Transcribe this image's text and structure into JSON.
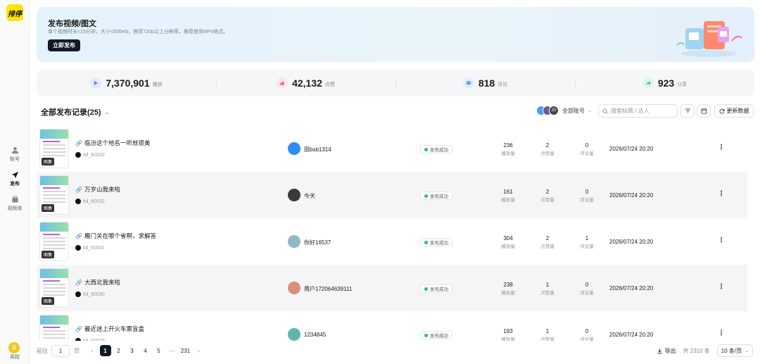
{
  "logo_text": "排停",
  "sidebar": {
    "items": [
      {
        "label": "账号",
        "icon": "user-icon"
      },
      {
        "label": "发布",
        "icon": "send-icon"
      },
      {
        "label": "视频库",
        "icon": "library-icon"
      }
    ],
    "user": {
      "avatar_text": "周",
      "label": "周程"
    }
  },
  "banner": {
    "title": "发布视频/图文",
    "subtitle": "单个视频时长<15分钟，大小<500mb，推荐720p以上分辨率，推荐使用MP4格式。",
    "button": "立即发布"
  },
  "stats": [
    {
      "value": "7,370,901",
      "label": "播放",
      "color": "#5b7ef5",
      "icon": "play-icon"
    },
    {
      "value": "42,132",
      "label": "点赞",
      "color": "#f26b7a",
      "icon": "like-icon"
    },
    {
      "value": "818",
      "label": "评论",
      "color": "#4a9cf0",
      "icon": "comment-icon"
    },
    {
      "value": "923",
      "label": "分享",
      "color": "#3fc28a",
      "icon": "share-icon"
    }
  ],
  "list": {
    "title": "全部发布记录(25)",
    "accounts": {
      "count": "20",
      "label": "全部账号"
    },
    "search_placeholder": "搜索标题 / 达人",
    "refresh_label": "更新数据"
  },
  "thumb_tag": "图集",
  "status_label": "发布成功",
  "metric_labels": {
    "plays": "播放量",
    "likes": "点赞量",
    "comments": "评论量"
  },
  "rows": [
    {
      "title": "临汾这个地名一听就很美",
      "id": "tid_60033",
      "author": "田bsb1314",
      "avatar_color": "#2f8cf4",
      "plays": "236",
      "likes": "2",
      "comments": "0",
      "date": "2026/07/24 20:20"
    },
    {
      "title": "万岁山我来啦",
      "id": "tid_60032",
      "author": "今天",
      "avatar_color": "#3a3a3a",
      "plays": "161",
      "likes": "2",
      "comments": "0",
      "date": "2026/07/24 20:20"
    },
    {
      "title": "雁门关在哪个省啊，求解答",
      "id": "tid_60031",
      "author": "你好16537",
      "avatar_color": "#8fb8c9",
      "plays": "304",
      "likes": "2",
      "comments": "1",
      "date": "2026/07/24 20:20"
    },
    {
      "title": "大西北我来啦",
      "id": "tid_60030",
      "author": "用户172064639111",
      "avatar_color": "#d98f7a",
      "plays": "238",
      "likes": "1",
      "comments": "0",
      "date": "2026/07/24 20:20"
    },
    {
      "title": "最近迷上开火车票盲盒",
      "id": "tid_60029",
      "author": "1234845",
      "avatar_color": "#5fb6b0",
      "plays": "193",
      "likes": "1",
      "comments": "0",
      "date": "2026/07/24 20:20"
    }
  ],
  "pagination": {
    "goto_label": "前往",
    "goto_value": "1",
    "page_unit": "页",
    "pages": [
      "1",
      "2",
      "3",
      "4",
      "5",
      "···",
      "231"
    ],
    "current": "1"
  },
  "footer": {
    "export_label": "导出",
    "total_label": "共 2310 条",
    "page_size": "10 条/页"
  }
}
